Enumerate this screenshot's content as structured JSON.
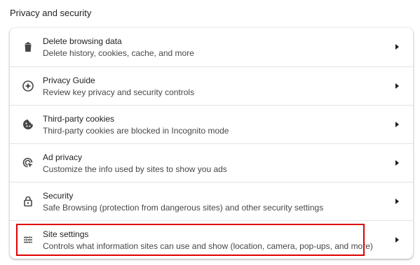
{
  "section": {
    "title": "Privacy and security"
  },
  "rows": [
    {
      "title": "Delete browsing data",
      "subtitle": "Delete history, cookies, cache, and more",
      "icon": "trash-icon"
    },
    {
      "title": "Privacy Guide",
      "subtitle": "Review key privacy and security controls",
      "icon": "compass-icon"
    },
    {
      "title": "Third-party cookies",
      "subtitle": "Third-party cookies are blocked in Incognito mode",
      "icon": "cookie-icon"
    },
    {
      "title": "Ad privacy",
      "subtitle": "Customize the info used by sites to show you ads",
      "icon": "ad-privacy-icon"
    },
    {
      "title": "Security",
      "subtitle": "Safe Browsing (protection from dangerous sites) and other security settings",
      "icon": "lock-icon"
    },
    {
      "title": "Site settings",
      "subtitle": "Controls what information sites can use and show (location, camera, pop-ups, and more)",
      "icon": "tune-icon"
    }
  ],
  "colors": {
    "highlight": "#e00000",
    "divider": "#e3e3e3"
  }
}
